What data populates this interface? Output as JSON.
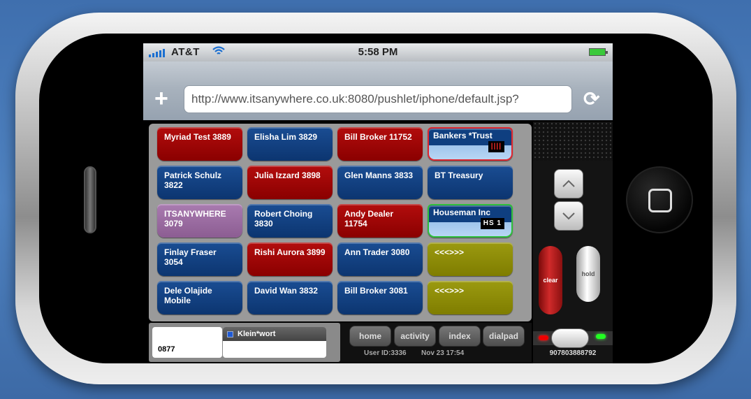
{
  "status": {
    "carrier": "AT&T",
    "time": "5:58 PM"
  },
  "browser": {
    "url": "http://www.itsanywhere.co.uk:8080/pushlet/iphone/default.jsp?",
    "add_glyph": "+",
    "refresh_glyph": "⟳"
  },
  "keys": [
    {
      "label": "Myriad Test 3889",
      "color": "red"
    },
    {
      "label": "Elisha Lim 3829",
      "color": "blue"
    },
    {
      "label": "Bill Broker 11752",
      "color": "red"
    },
    {
      "label": "Bankers *Trust",
      "color": "light",
      "tag": "||||",
      "border": "red"
    },
    {
      "label": "Patrick Schulz 3822",
      "color": "blue"
    },
    {
      "label": "Julia Izzard 3898",
      "color": "red"
    },
    {
      "label": "Glen Manns 3833",
      "color": "blue"
    },
    {
      "label": "BT Treasury",
      "color": "blue"
    },
    {
      "label": "ITSANYWHERE 3079",
      "color": "purple"
    },
    {
      "label": "Robert Choing 3830",
      "color": "blue"
    },
    {
      "label": "Andy Dealer 11754",
      "color": "red"
    },
    {
      "label": "Houseman Inc",
      "color": "light",
      "tag": "HS 1",
      "border": "green"
    },
    {
      "label": "Finlay Fraser 3054",
      "color": "blue"
    },
    {
      "label": "Rishi Aurora 3899",
      "color": "red"
    },
    {
      "label": "Ann Trader 3080",
      "color": "blue"
    },
    {
      "label": "<<<>>>",
      "color": "olive"
    },
    {
      "label": "Dele Olajide Mobile",
      "color": "blue"
    },
    {
      "label": "David Wan 3832",
      "color": "blue"
    },
    {
      "label": "Bill Broker 3081",
      "color": "blue"
    },
    {
      "label": "<<<>>>",
      "color": "olive"
    }
  ],
  "controls": {
    "clear_label": "clear",
    "hold_label": "hold",
    "phone_number": "907803888792"
  },
  "bottom": {
    "display_number": "0877",
    "line_name": "Klein*wort",
    "nav": [
      "home",
      "activity",
      "index",
      "dialpad"
    ],
    "user_id": "User ID:3336",
    "datetime": "Nov 23 17:54"
  }
}
